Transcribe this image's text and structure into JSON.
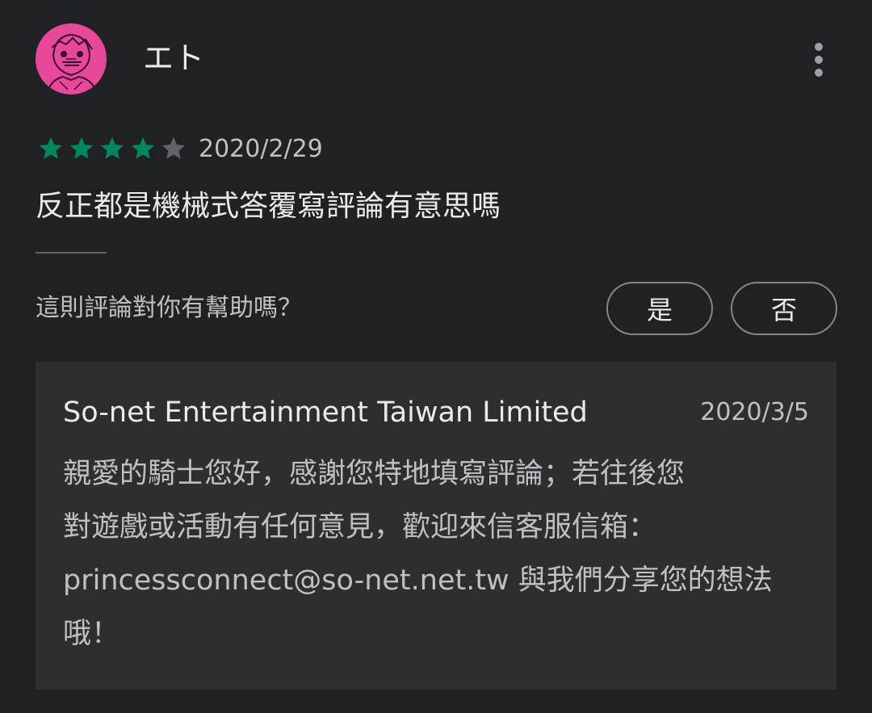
{
  "review": {
    "reviewer_name": "エト",
    "rating": 4,
    "max_rating": 5,
    "date": "2020/2/29",
    "text": "反正都是機械式答覆寫評論有意思嗎",
    "avatar_icon": "anime-character-avatar-icon",
    "more_icon": "more-vert-icon"
  },
  "helpful": {
    "question": "這則評論對你有幫助嗎？",
    "yes_label": "是",
    "no_label": "否"
  },
  "reply": {
    "developer": "So-net Entertainment Taiwan Limited",
    "date": "2020/3/5",
    "lines": [
      "親愛的騎士您好，感謝您特地填寫評論；若往後您",
      "對遊戲或活動有任何意見，歡迎來信客服信箱：",
      "princessconnect@so-net.net.tw 與我們分享您的想法",
      "哦！"
    ]
  },
  "colors": {
    "background": "#202124",
    "reply_background": "#2d2e31",
    "star_filled": "#01875f",
    "star_empty": "#5f6368",
    "avatar_pink": "#e8489a"
  }
}
